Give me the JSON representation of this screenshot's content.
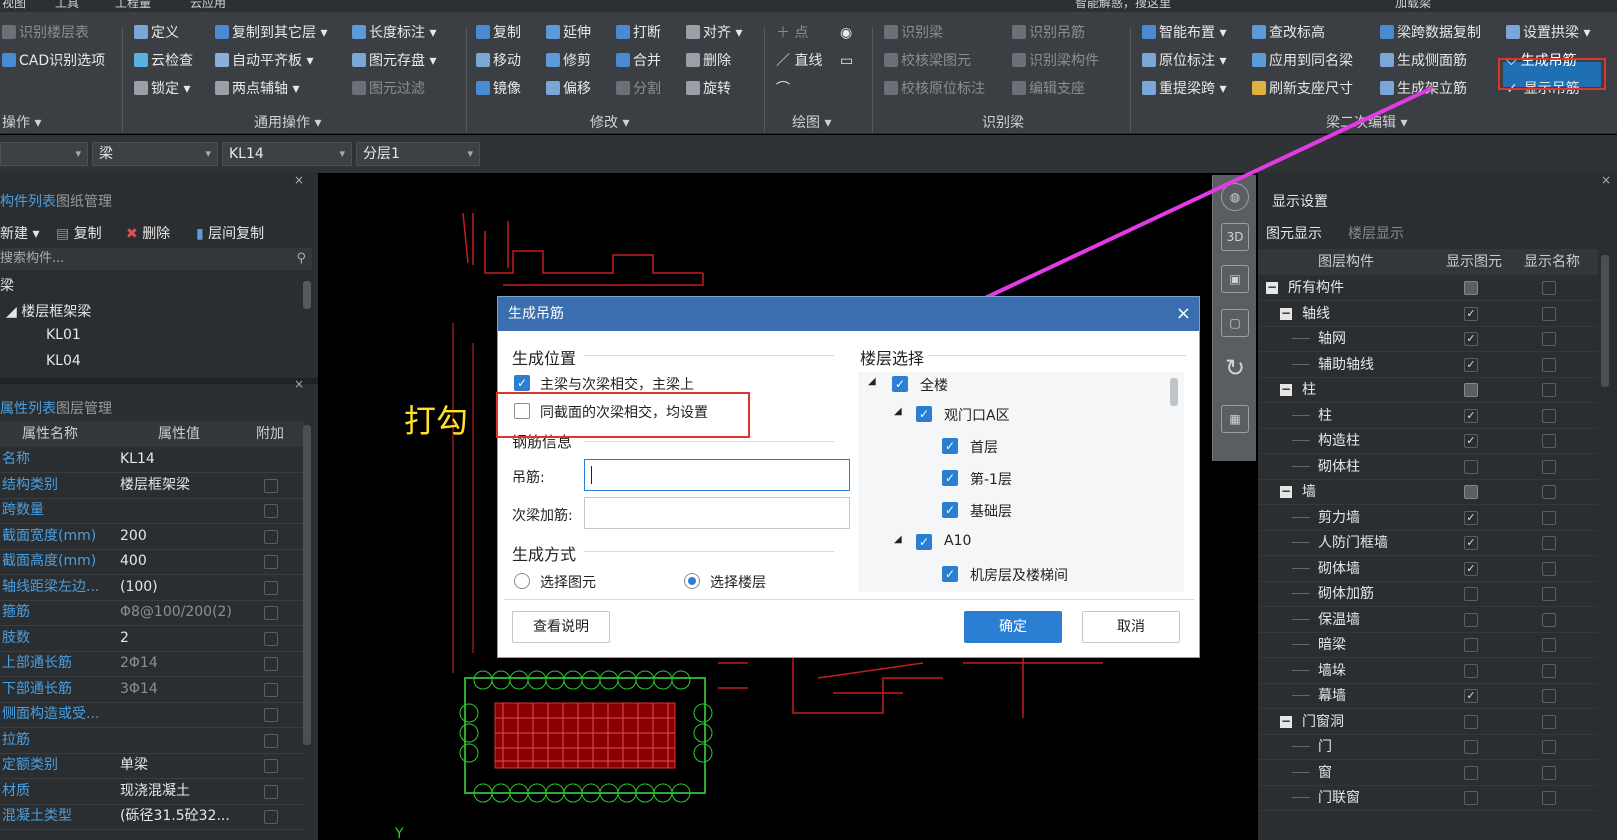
{
  "topbar": {
    "items": [
      "视图",
      "工具",
      "工程量",
      "云应用"
    ],
    "right_text": "智能解惑，搜这里",
    "right_btn": "加载梁"
  },
  "ribbon": {
    "col0": [
      "识别楼层表",
      "CAD识别选项"
    ],
    "col0_label": "操作",
    "col1": [
      "定义",
      "云检查",
      "锁定"
    ],
    "col2": [
      "复制到其它层",
      "自动平齐板",
      "两点辅轴"
    ],
    "col3": [
      "长度标注",
      "图元存盘",
      "图元过滤"
    ],
    "general_label": "通用操作",
    "col4": [
      "复制",
      "移动",
      "镜像"
    ],
    "col5": [
      "延伸",
      "修剪",
      "偏移"
    ],
    "col6": [
      "打断",
      "合并",
      "分割"
    ],
    "col7": [
      "对齐",
      "删除",
      "旋转"
    ],
    "modify_label": "修改",
    "col8": [
      "点",
      "直线"
    ],
    "draw_label": "绘图",
    "col9": [
      "识别梁",
      "校核梁图元",
      "校核原位标注"
    ],
    "col10": [
      "识别吊筋",
      "识别梁构件",
      "编辑支座"
    ],
    "recognize_label": "识别梁",
    "col11": [
      "智能布置",
      "原位标注",
      "重提梁跨"
    ],
    "col12": [
      "查改标高",
      "应用到同名梁",
      "刷新支座尺寸"
    ],
    "col13": [
      "梁跨数据复制",
      "生成侧面筋",
      "生成架立筋"
    ],
    "col14": [
      "设置拱梁",
      "生成吊筋",
      "显示吊筋"
    ],
    "secondary_label": "梁二次编辑"
  },
  "selectors": {
    "s1": "",
    "s2": "梁",
    "s3": "KL14",
    "s4": "分层1"
  },
  "left_top": {
    "tabs": [
      "构件列表",
      "图纸管理"
    ],
    "actions": [
      "新建",
      "复制",
      "删除",
      "层间复制"
    ],
    "search_placeholder": "搜索构件...",
    "tree": [
      "梁",
      "楼层框架梁",
      "KL01",
      "KL04"
    ]
  },
  "left_bottom": {
    "tabs": [
      "属性列表",
      "图层管理"
    ],
    "headers": [
      "属性名称",
      "属性值",
      "附加"
    ],
    "rows": [
      {
        "k": "名称",
        "v": "KL14"
      },
      {
        "k": "结构类别",
        "v": "楼层框架梁"
      },
      {
        "k": "跨数量",
        "v": ""
      },
      {
        "k": "截面宽度(mm)",
        "v": "200"
      },
      {
        "k": "截面高度(mm)",
        "v": "400"
      },
      {
        "k": "轴线距梁左边...",
        "v": "(100)"
      },
      {
        "k": "箍筋",
        "v": "Φ8@100/200(2)"
      },
      {
        "k": "肢数",
        "v": "2"
      },
      {
        "k": "上部通长筋",
        "v": "2Φ14"
      },
      {
        "k": "下部通长筋",
        "v": "3Φ14"
      },
      {
        "k": "侧面构造或受...",
        "v": ""
      },
      {
        "k": "拉筋",
        "v": ""
      },
      {
        "k": "定额类别",
        "v": "单梁"
      },
      {
        "k": "材质",
        "v": "现浇混凝土"
      },
      {
        "k": "混凝土类型",
        "v": "(砾径31.5砼32..."
      }
    ]
  },
  "dialog": {
    "title": "生成吊筋",
    "close": "×",
    "pos_label": "生成位置",
    "opt1": "主梁与次梁相交，主梁上",
    "opt2": "同截面的次梁相交，均设置",
    "rebar_label": "钢筋信息",
    "hanger_label": "吊筋:",
    "hanger_value": "",
    "secondary_label": "次梁加筋:",
    "secondary_value": "",
    "mode_label": "生成方式",
    "mode1": "选择图元",
    "mode2": "选择楼层",
    "floor_label": "楼层选择",
    "floors": [
      "全楼",
      "观门口A区",
      "首层",
      "第-1层",
      "基础层",
      "A10",
      "机房层及楼梯间"
    ],
    "btn_help": "查看说明",
    "btn_ok": "确定",
    "btn_cancel": "取消"
  },
  "annotation": "打勾",
  "display": {
    "title": "显示设置",
    "tabs": [
      "图元显示",
      "楼层显示"
    ],
    "headers": [
      "图层构件",
      "显示图元",
      "显示名称"
    ],
    "rows": [
      {
        "n": "所有构件",
        "g": true,
        "a": "part",
        "b": ""
      },
      {
        "n": "轴线",
        "g": true,
        "a": "✓",
        "b": ""
      },
      {
        "n": "轴网",
        "g": false,
        "a": "✓",
        "b": ""
      },
      {
        "n": "辅助轴线",
        "g": false,
        "a": "✓",
        "b": ""
      },
      {
        "n": "柱",
        "g": true,
        "a": "part",
        "b": ""
      },
      {
        "n": "柱",
        "g": false,
        "a": "✓",
        "b": ""
      },
      {
        "n": "构造柱",
        "g": false,
        "a": "✓",
        "b": ""
      },
      {
        "n": "砌体柱",
        "g": false,
        "a": "",
        "b": ""
      },
      {
        "n": "墙",
        "g": true,
        "a": "part",
        "b": ""
      },
      {
        "n": "剪力墙",
        "g": false,
        "a": "✓",
        "b": ""
      },
      {
        "n": "人防门框墙",
        "g": false,
        "a": "✓",
        "b": ""
      },
      {
        "n": "砌体墙",
        "g": false,
        "a": "✓",
        "b": ""
      },
      {
        "n": "砌体加筋",
        "g": false,
        "a": "",
        "b": ""
      },
      {
        "n": "保温墙",
        "g": false,
        "a": "",
        "b": ""
      },
      {
        "n": "暗梁",
        "g": false,
        "a": "",
        "b": ""
      },
      {
        "n": "墙垛",
        "g": false,
        "a": "",
        "b": ""
      },
      {
        "n": "幕墙",
        "g": false,
        "a": "✓",
        "b": ""
      },
      {
        "n": "门窗洞",
        "g": true,
        "a": "",
        "b": ""
      },
      {
        "n": "门",
        "g": false,
        "a": "",
        "b": ""
      },
      {
        "n": "窗",
        "g": false,
        "a": "",
        "b": ""
      },
      {
        "n": "门联窗",
        "g": false,
        "a": "",
        "b": ""
      }
    ]
  },
  "colors": {
    "accent": "#2b7fd3",
    "highlight": "#e0332a",
    "arrow": "#e23be6",
    "annotation": "#ffe02a"
  }
}
